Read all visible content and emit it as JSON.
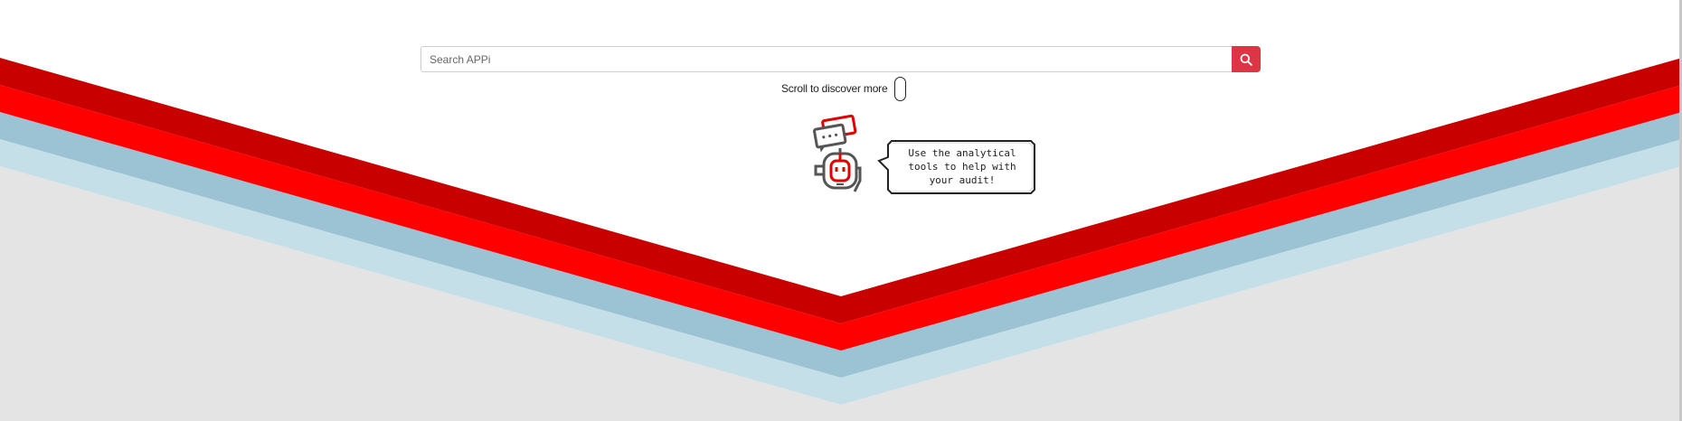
{
  "search": {
    "placeholder": "Search APPi",
    "value": "",
    "button_icon": "search-icon"
  },
  "scroll_hint": {
    "label": "Scroll to discover more",
    "icon": "mouse-icon"
  },
  "mascot": {
    "icon": "robot-chat-icon",
    "speech_lines": [
      "Use the analytical",
      "tools to help with",
      "your audit!"
    ]
  },
  "colors": {
    "dark_red": "#c90000",
    "red": "#ff0000",
    "steel_blue": "#9bc3d4",
    "light_blue": "#c5dfe8",
    "background_gray": "#e4e4e4",
    "search_button": "#dc3545"
  }
}
